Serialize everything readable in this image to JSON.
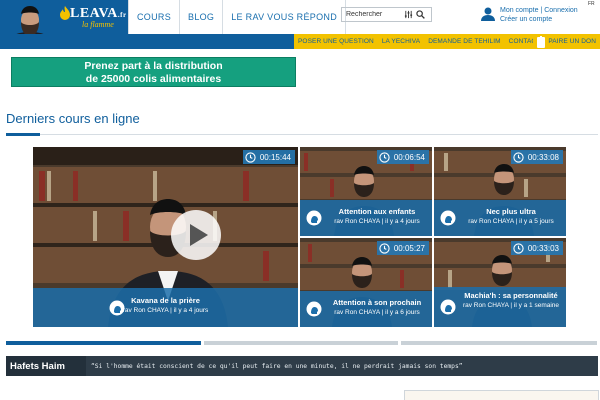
{
  "header": {
    "logo_text": "LEAVA",
    "logo_suffix": ".fr",
    "logo_tagline": "la flamme",
    "nav": [
      "COURS",
      "BLOG",
      "LE RAV VOUS RÉPOND"
    ],
    "search": {
      "value": "Rechercher"
    },
    "account": {
      "line1": "Mon compte | Connexion",
      "line2": "Créer un compte"
    },
    "language_badge": "FR"
  },
  "subnav": {
    "items": [
      "POSER UNE QUESTION",
      "LA YECHIVA",
      "DEMANDE DE TEHILIM",
      "CONTACT"
    ],
    "last": "PAIRE UN DON"
  },
  "banner": {
    "line1": "Prenez part à la distribution",
    "line2": "de 25000 colis alimentaires"
  },
  "section": {
    "title": "Derniers cours en ligne"
  },
  "tiles": [
    {
      "time": "00:15:44",
      "title": "Kavana de la prière",
      "sub": "rav Ron CHAYA | il y a 4 jours"
    },
    {
      "time": "00:06:54",
      "title": "Attention aux enfants",
      "sub": "rav Ron CHAYA | il y a 4 jours"
    },
    {
      "time": "00:33:08",
      "title": "Nec plus ultra",
      "sub": "rav Ron CHAYA | il y a 5 jours"
    },
    {
      "time": "00:05:27",
      "title": "Attention à son prochain",
      "sub": "rav Ron CHAYA | il y a 6 jours"
    },
    {
      "time": "00:33:03",
      "title": "Machia'h : sa personnalité",
      "sub": "rav Ron CHAYA | il y a 1 semaine"
    }
  ],
  "carousel": {
    "segments": 3,
    "active": 0
  },
  "quote": {
    "label": "Hafets Haim",
    "text": "“Si l'homme était conscient de ce qu'il peut faire en une minute, il ne perdrait jamais son temps”"
  },
  "colors": {
    "primary": "#0f5e9c",
    "accent": "#f2c200",
    "banner": "#15a07f",
    "dark": "#2e3c48"
  }
}
